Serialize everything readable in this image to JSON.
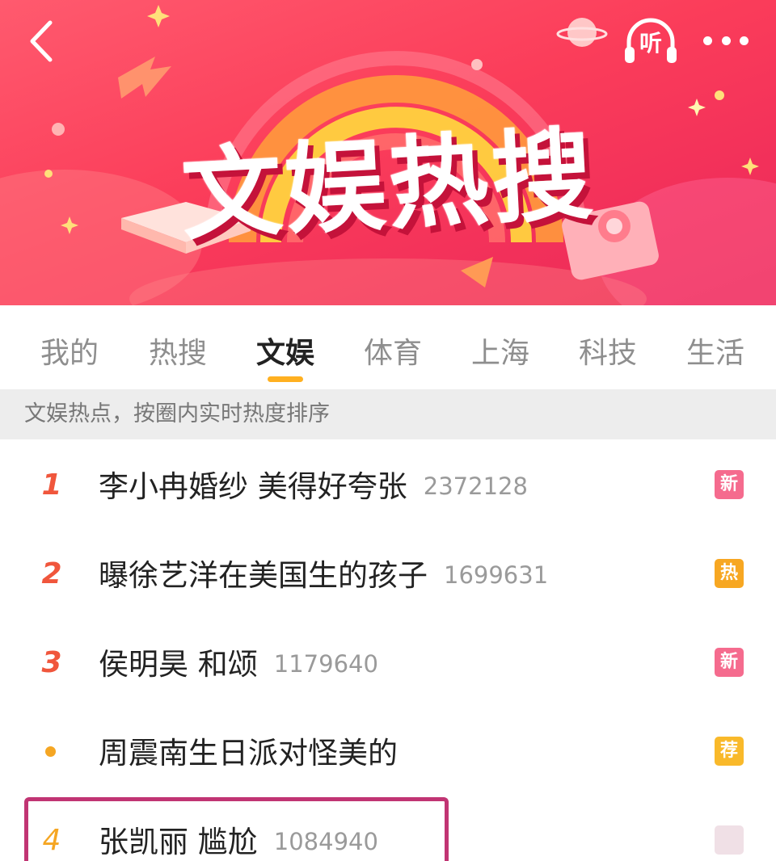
{
  "header": {
    "banner_title": "文娱热搜",
    "listen_label": "听",
    "back_icon": "back-arrow-icon",
    "more_icon": "more-dots-icon",
    "brand_colors": {
      "banner_red": "#fb3d5a",
      "accent_yellow": "#ffb020",
      "title_shadow": "#c4123a"
    }
  },
  "tabs": [
    {
      "label": "我的"
    },
    {
      "label": "热搜"
    },
    {
      "label": "文娱",
      "active": true
    },
    {
      "label": "体育"
    },
    {
      "label": "上海"
    },
    {
      "label": "科技"
    },
    {
      "label": "生活"
    }
  ],
  "subtitle": "文娱热点，按圈内实时热度排序",
  "list": [
    {
      "rank": "1",
      "title": "李小冉婚纱 美得好夸张",
      "count": "2372128",
      "badge": "新"
    },
    {
      "rank": "2",
      "title": "曝徐艺洋在美国生的孩子",
      "count": "1699631",
      "badge": "热"
    },
    {
      "rank": "3",
      "title": "侯明昊 和颂",
      "count": "1179640",
      "badge": "新"
    },
    {
      "rank": "",
      "title": "周震南生日派对怪美的",
      "count": "",
      "badge": "荐"
    },
    {
      "rank": "4",
      "title": "张凯丽 尴尬",
      "count": "1084940",
      "badge": ""
    }
  ]
}
